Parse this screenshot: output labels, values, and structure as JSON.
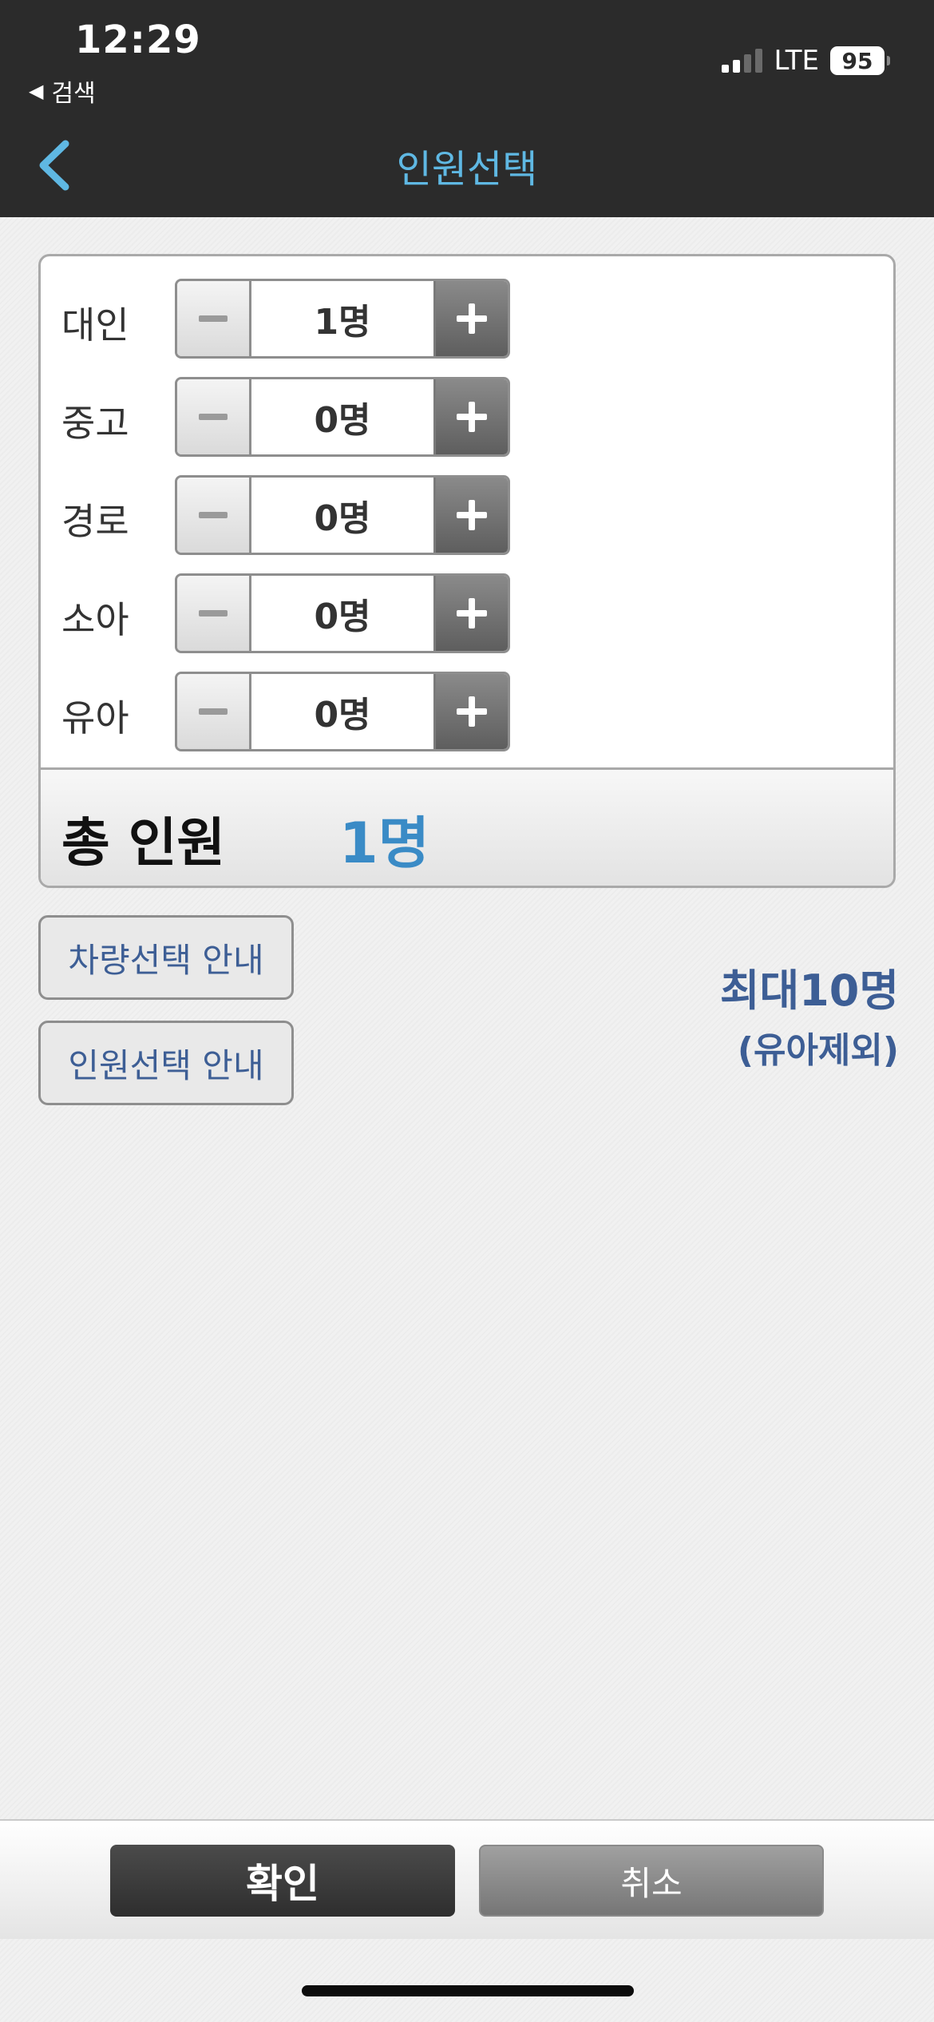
{
  "status_bar": {
    "time": "12:29",
    "back_label": "검색",
    "network": "LTE",
    "battery": "95"
  },
  "nav": {
    "title": "인원선택"
  },
  "passengers": [
    {
      "label": "대인",
      "value": "1명"
    },
    {
      "label": "중고",
      "value": "0명"
    },
    {
      "label": "경로",
      "value": "0명"
    },
    {
      "label": "소아",
      "value": "0명"
    },
    {
      "label": "유아",
      "value": "0명"
    }
  ],
  "total": {
    "label": "총 인원",
    "value": "1명"
  },
  "info_buttons": {
    "vehicle_guide": "차량선택 안내",
    "passenger_guide": "인원선택 안내"
  },
  "max_note": {
    "line1": "최대10명",
    "line2": "(유아제외)"
  },
  "actions": {
    "confirm": "확인",
    "cancel": "취소"
  },
  "colors": {
    "accent_title": "#5fb8e3",
    "total_value": "#3a8bc6",
    "link_text": "#3d5e95"
  }
}
